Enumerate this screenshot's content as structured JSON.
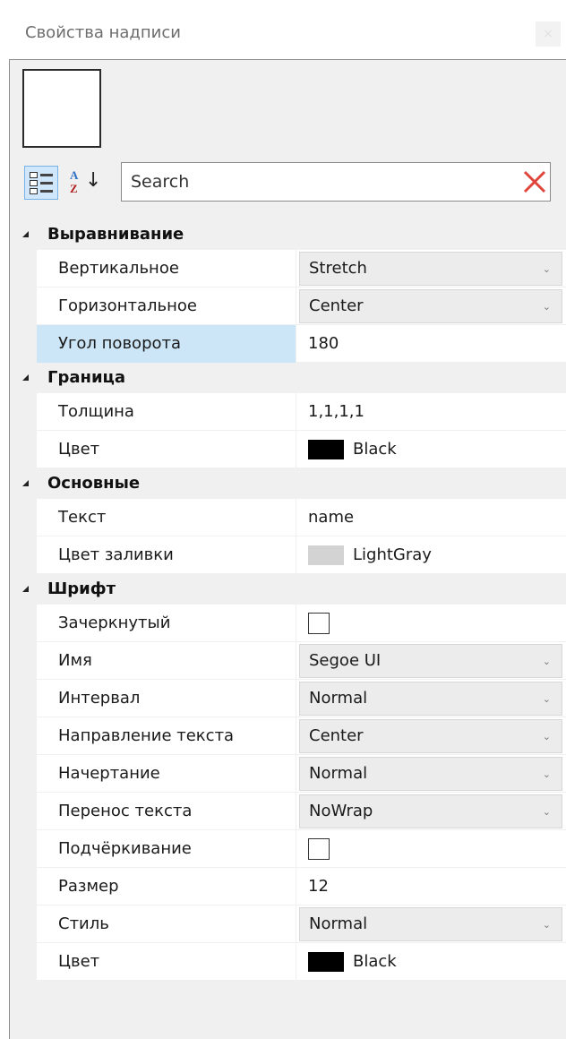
{
  "window": {
    "title": "Свойства надписи",
    "close_label": "×"
  },
  "search": {
    "placeholder": "Search"
  },
  "colors": {
    "accent_selected": "#cde6f7",
    "clear_icon": "#e0453b",
    "black": "#000000",
    "lightgray": "#d3d3d3"
  },
  "categories": [
    {
      "label": "Выравнивание",
      "props": [
        {
          "name": "Вертикальное",
          "type": "combo",
          "value": "Stretch"
        },
        {
          "name": "Горизонтальное",
          "type": "combo",
          "value": "Center"
        },
        {
          "name": "Угол поворота",
          "type": "text",
          "value": "180",
          "selected": true
        }
      ]
    },
    {
      "label": "Граница",
      "props": [
        {
          "name": "Толщина",
          "type": "text",
          "value": "1,1,1,1"
        },
        {
          "name": "Цвет",
          "type": "color",
          "value": "Black",
          "color": "#000000"
        }
      ]
    },
    {
      "label": "Основные",
      "props": [
        {
          "name": "Текст",
          "type": "text",
          "value": "name"
        },
        {
          "name": "Цвет заливки",
          "type": "color",
          "value": "LightGray",
          "color": "#d3d3d3"
        }
      ]
    },
    {
      "label": "Шрифт",
      "props": [
        {
          "name": "Зачеркнутый",
          "type": "checkbox",
          "checked": false
        },
        {
          "name": "Имя",
          "type": "combo",
          "value": "Segoe UI"
        },
        {
          "name": "Интервал",
          "type": "combo",
          "value": "Normal"
        },
        {
          "name": "Направление текста",
          "type": "combo",
          "value": "Center"
        },
        {
          "name": "Начертание",
          "type": "combo",
          "value": "Normal"
        },
        {
          "name": "Перенос текста",
          "type": "combo",
          "value": "NoWrap"
        },
        {
          "name": "Подчёркивание",
          "type": "checkbox",
          "checked": false
        },
        {
          "name": "Размер",
          "type": "text",
          "value": "12"
        },
        {
          "name": "Стиль",
          "type": "combo",
          "value": "Normal"
        },
        {
          "name": "Цвет",
          "type": "color",
          "value": "Black",
          "color": "#000000"
        }
      ]
    }
  ]
}
